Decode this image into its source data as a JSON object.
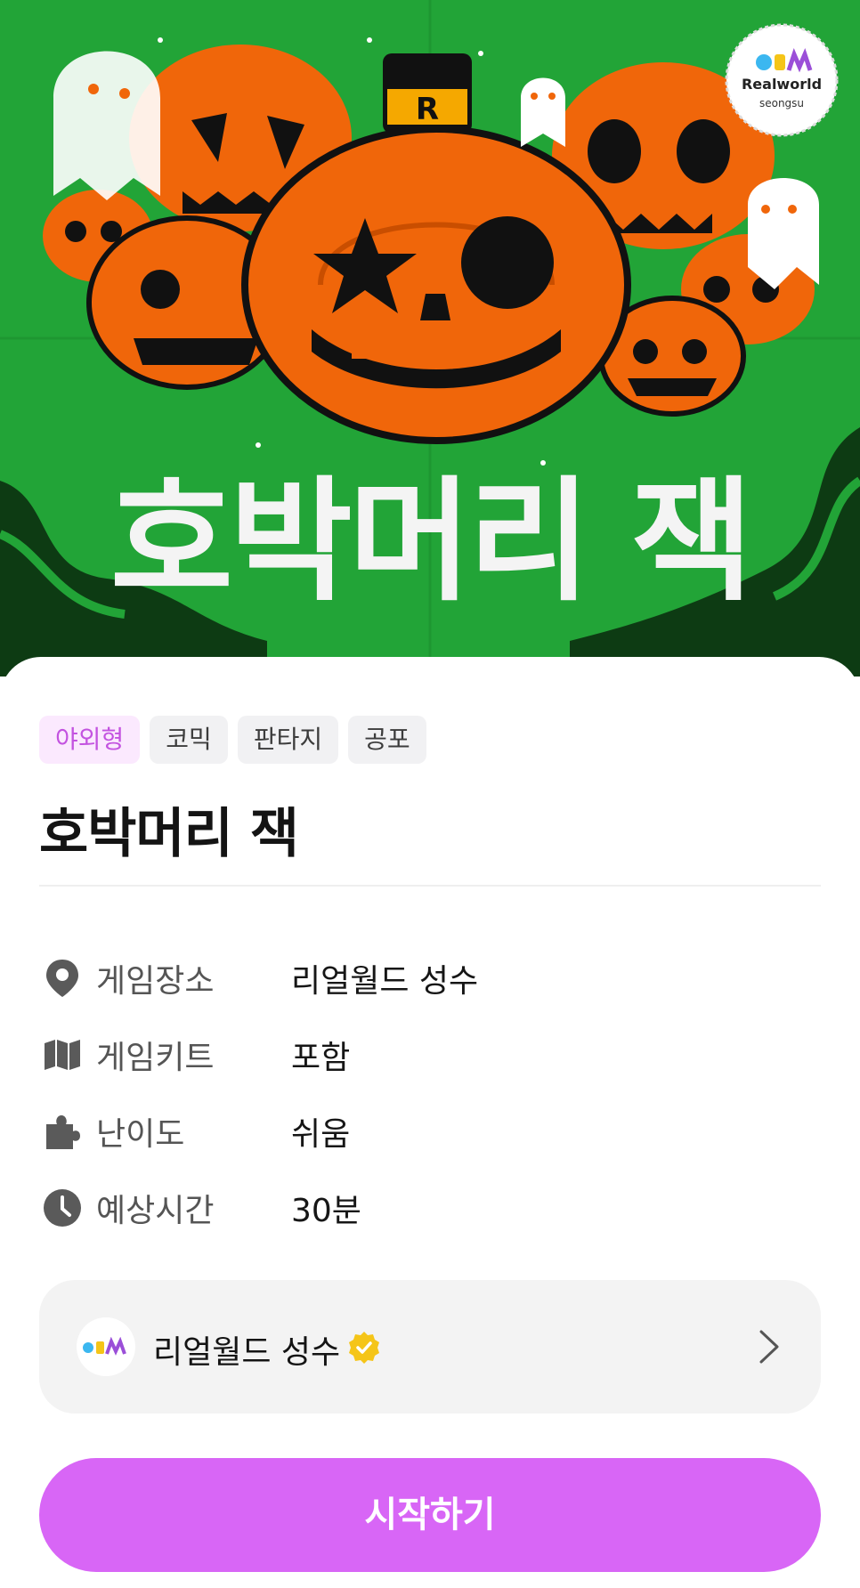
{
  "hero": {
    "title_art": "호박머리 잭",
    "badge": {
      "brand": "Realworld",
      "location": "seongsu"
    },
    "colors": {
      "background": "#22a437",
      "pumpkin": "#f0660a",
      "accent_stripe": "#0d3b13"
    }
  },
  "tags": [
    {
      "label": "야외형",
      "highlight": true
    },
    {
      "label": "코믹",
      "highlight": false
    },
    {
      "label": "판타지",
      "highlight": false
    },
    {
      "label": "공포",
      "highlight": false
    }
  ],
  "title": "호박머리 잭",
  "info": [
    {
      "icon": "location-pin-icon",
      "label": "게임장소",
      "value": "리얼월드 성수"
    },
    {
      "icon": "map-icon",
      "label": "게임키트",
      "value": "포함"
    },
    {
      "icon": "puzzle-icon",
      "label": "난이도",
      "value": "쉬움"
    },
    {
      "icon": "clock-icon",
      "label": "예상시간",
      "value": "30분"
    }
  ],
  "venue": {
    "name": "리얼월드 성수",
    "verified": true
  },
  "cta": {
    "label": "시작하기"
  },
  "colors": {
    "accent": "#d866f6",
    "tag_highlight_text": "#c353e0",
    "verified": "#f5c518"
  }
}
